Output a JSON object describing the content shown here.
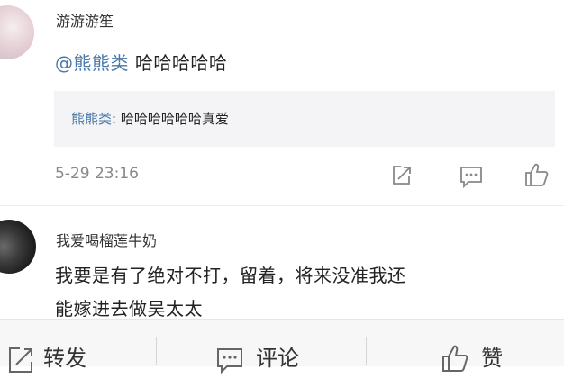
{
  "comments": [
    {
      "username": "游游游笙",
      "mention": "@熊熊类",
      "text": "哈哈哈哈哈",
      "quote": {
        "user": "熊熊类",
        "sep": ":",
        "text": " 哈哈哈哈哈哈真爱"
      },
      "time": "5-29 23:16"
    },
    {
      "username": "我爱喝榴莲牛奶",
      "text_line1": "我要是有了绝对不打，留着，将来没准我还",
      "text_line2": "能嫁进去做吴太太"
    }
  ],
  "bottom_bar": {
    "repost_label": "转发",
    "comment_label": "评论",
    "like_label": "赞"
  }
}
